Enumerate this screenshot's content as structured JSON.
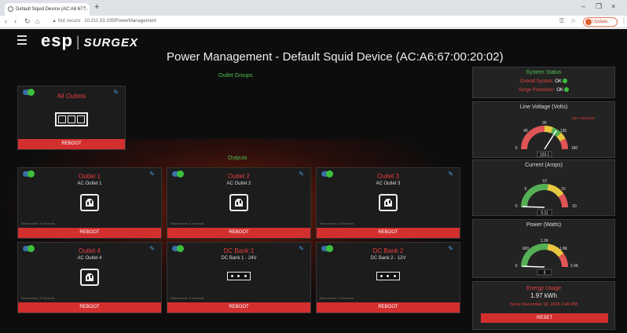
{
  "browser": {
    "tab_title": "Default Squid Device (AC:A6:67:...",
    "tab_close": "×",
    "new_tab": "+",
    "win_min": "–",
    "win_max": "❐",
    "win_close": "×",
    "nav_back": "‹",
    "nav_forward": "›",
    "nav_reload": "↻",
    "nav_home": "⌂",
    "security_text": "▲ Not secure",
    "url": "10.211.53.105/PowerManagement",
    "key_icon": "⚿",
    "star_icon": "☆",
    "update_label": "Update",
    "menu_icon": "⋮"
  },
  "app": {
    "logo_esp": "esp",
    "logo_sep": "|",
    "logo_surge": "SURGEX",
    "page_title": "Power Management - Default Squid Device (AC:A6:67:00:20:02)",
    "outlet_groups_label": "Outlet Groups",
    "outputs_label": "Outputs"
  },
  "group": {
    "title": "All Outlets",
    "reboot": "REBOOT"
  },
  "outlets": [
    {
      "title": "Outlet 1",
      "sub": "AC Outlet 1",
      "note": "Reboot time: 5 Seconds",
      "reboot": "REBOOT",
      "icon": "ac"
    },
    {
      "title": "Outlet 2",
      "sub": "AC Outlet 2",
      "note": "Reboot time: 5 Seconds",
      "reboot": "REBOOT",
      "icon": "ac"
    },
    {
      "title": "Outlet 3",
      "sub": "AC Outlet 3",
      "note": "Reboot time: 5 Seconds",
      "reboot": "REBOOT",
      "icon": "ac"
    },
    {
      "title": "Outlet 4",
      "sub": "AC Outlet 4",
      "note": "Reboot time: 5 Seconds",
      "reboot": "REBOOT",
      "icon": "ac"
    },
    {
      "title": "DC Bank 1",
      "sub": "DC Bank 1 - 24V",
      "note": "Reboot time: 5 Seconds",
      "reboot": "REBOOT",
      "icon": "dc"
    },
    {
      "title": "DC Bank 2",
      "sub": "DC Bank 2 - 12V",
      "note": "Reboot time: 5 Seconds",
      "reboot": "REBOOT",
      "icon": "dc"
    }
  ],
  "system_status": {
    "title": "System Status",
    "overall_label": "Overall System:",
    "overall_value": "OK",
    "surge_label": "Surge Protection:",
    "surge_value": "OK"
  },
  "gauges": {
    "voltage": {
      "title": "Line Voltage (Volts)",
      "min": "0",
      "max": "180",
      "t1": "45",
      "t2": "90",
      "t3": "135",
      "note": "120 V Nominal",
      "value": "123.1",
      "fraction": 0.68
    },
    "current": {
      "title": "Current (Amps)",
      "min": "0",
      "max": "20",
      "t1": "5",
      "t2": "10",
      "t3": "15",
      "value": "0.11",
      "fraction": 0.01
    },
    "power": {
      "title": "Power (Watts)",
      "min": "0",
      "max": "2.4K",
      "t1": "600",
      "t2": "1.2K",
      "t3": "1.8K",
      "value": "3",
      "fraction": 0.01
    }
  },
  "energy": {
    "title": "Energy Usage",
    "value": "1.97 kWh",
    "since": "Since December 18, 2020 2:40 PM",
    "reset": "RESET"
  },
  "colors": {
    "accent_red": "#d32f2f",
    "title_red": "#e83c3c",
    "green": "#3cc03c",
    "pencil_blue": "#4aa0e0"
  }
}
